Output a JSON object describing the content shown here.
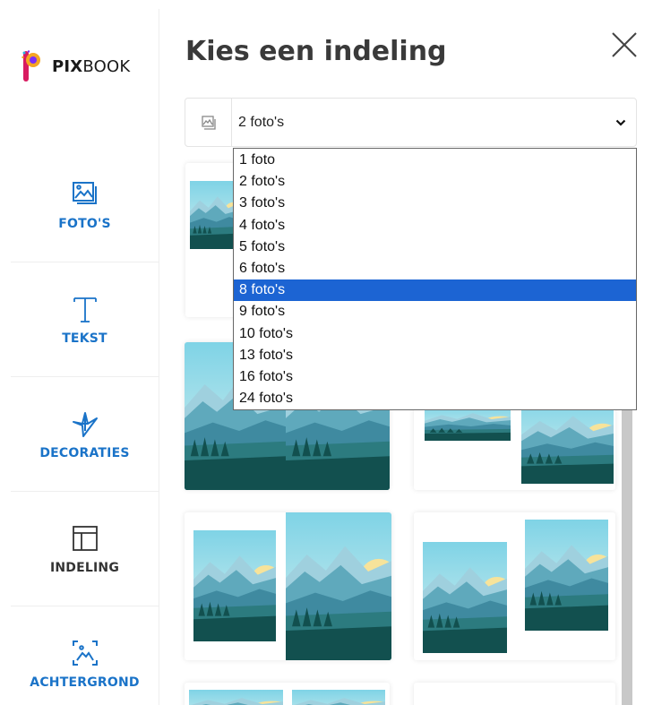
{
  "brand": {
    "logo_strong": "PIX",
    "logo_rest": "BOOK"
  },
  "sidebar": {
    "items": [
      {
        "label": "FOTO'S",
        "icon": "photo-icon"
      },
      {
        "label": "TEKST",
        "icon": "text-icon"
      },
      {
        "label": "DECORATIES",
        "icon": "origami-bird-icon"
      },
      {
        "label": "INDELING",
        "icon": "layout-icon",
        "active": true
      },
      {
        "label": "ACHTERGROND",
        "icon": "background-image-icon"
      }
    ]
  },
  "panel": {
    "title": "Kies een indeling",
    "select": {
      "value": "2 foto's",
      "options": [
        "1 foto",
        "2 foto's",
        "3 foto's",
        "4 foto's",
        "5 foto's",
        "6 foto's",
        "8 foto's",
        "9 foto's",
        "10 foto's",
        "13 foto's",
        "16 foto's",
        "24 foto's"
      ],
      "highlighted": "8 foto's"
    }
  },
  "colors": {
    "accent": "#1a73c8",
    "highlight": "#1c64d3",
    "sky": "#7fd3e6",
    "sun": "#f7e39a",
    "mountain": "#3f8aa0",
    "forest": "#12504f"
  }
}
